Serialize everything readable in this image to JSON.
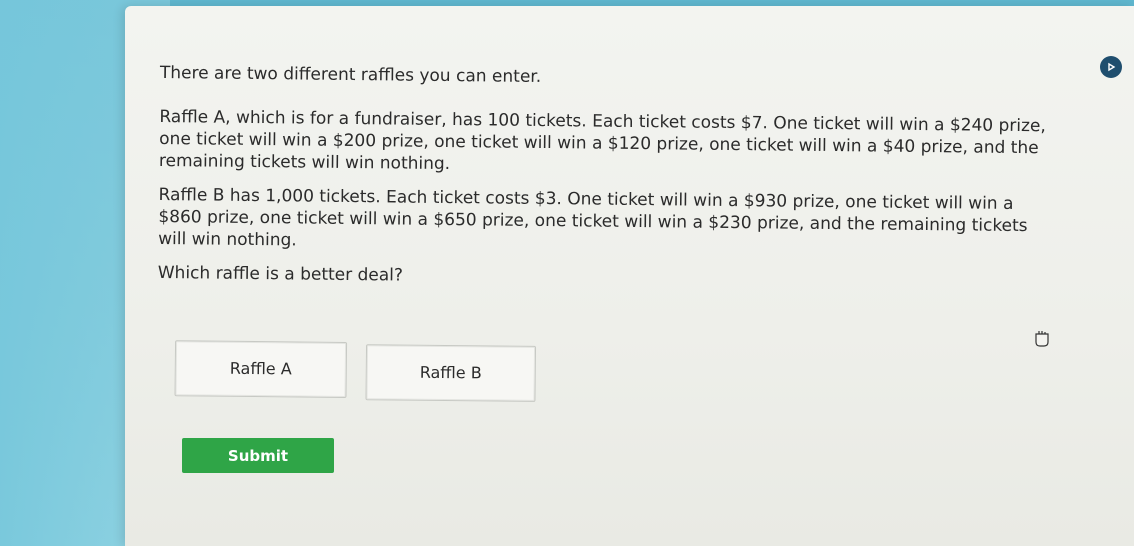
{
  "question": {
    "intro": "There are two different raffles you can enter.",
    "raffle_a": "Raffle A, which is for a fundraiser, has 100 tickets. Each ticket costs $7. One ticket will win a $240 prize, one ticket will win a $200 prize, one ticket will win a $120 prize, one ticket will win a $40 prize, and the remaining tickets will win nothing.",
    "raffle_b": "Raffle B has 1,000 tickets. Each ticket costs $3. One ticket will win a $930 prize, one ticket will win a $860 prize, one ticket will win a $650 prize, one ticket will win a $230 prize, and the remaining tickets will win nothing.",
    "prompt": "Which raffle is a better deal?"
  },
  "choices": [
    "Raffle A",
    "Raffle B"
  ],
  "submit_label": "Submit",
  "icons": {
    "play": "play-icon",
    "cursor": "hand-pointer-icon"
  },
  "colors": {
    "submit": "#2fa547",
    "background": "#74c2d5",
    "panel": "#eeefea"
  }
}
